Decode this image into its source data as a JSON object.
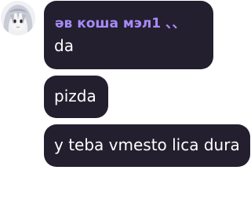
{
  "chat": {
    "sender_name": "әв коша мэл1 、、",
    "messages": [
      {
        "text": "da"
      },
      {
        "text": "pizda"
      },
      {
        "text": "y teba vmesto lica dura"
      }
    ]
  },
  "colors": {
    "bubble_background": "#231f2e",
    "sender_name": "#a78bfa",
    "message_text": "#ffffff",
    "page_background": "#ffffff"
  },
  "icons": {
    "avatar": "anime-character-avatar"
  }
}
